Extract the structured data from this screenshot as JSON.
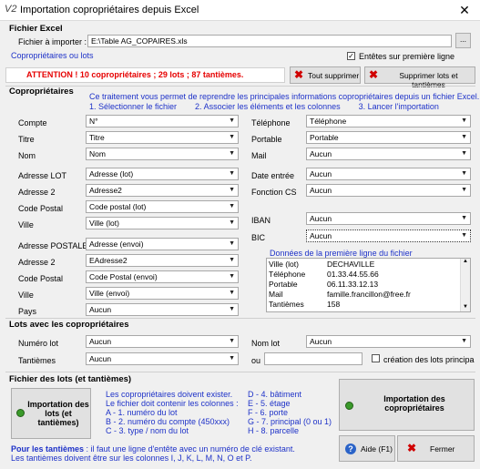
{
  "window": {
    "title": "Importation copropriétaires depuis Excel",
    "app_icon": "V2",
    "close_icon": "close-icon"
  },
  "fichier_excel": {
    "title": "Fichier Excel",
    "file_label": "Fichier à importer :",
    "file_value": "E:\\Table AG_COPAIRES.xls",
    "browse_label": "...",
    "subtitle": "Copropriétaires ou lots",
    "header_checkbox_label": "Entêtes sur première ligne",
    "header_checked": true
  },
  "warning": "ATTENTION ! 10 copropriétaires ; 29 lots ; 87 tantièmes.",
  "buttons": {
    "delete_all": "Tout supprimer",
    "delete_lots": "Supprimer lots et tantièmes",
    "import_lots": "Importation des lots (et tantièmes)",
    "import_owners": "Importation des copropriétaires",
    "help": "Aide (F1)",
    "close": "Fermer"
  },
  "coproprietaires": {
    "title": "Copropriétaires",
    "info": "Ce traitement vous permet de reprendre les principales informations copropriétaires depuis un fichier Excel.",
    "steps": "1. Sélectionner le fichier        2. Associer les éléments et les colonnes        3. Lancer l'importation",
    "left_fields": [
      {
        "label": "Compte",
        "value": "N°"
      },
      {
        "label": "Titre",
        "value": "Titre"
      },
      {
        "label": "Nom",
        "value": "Nom"
      },
      {
        "label": "Adresse LOT",
        "value": "Adresse (lot)"
      },
      {
        "label": "Adresse 2",
        "value": "Adresse2"
      },
      {
        "label": "Code Postal",
        "value": "Code postal (lot)"
      },
      {
        "label": "Ville",
        "value": "Ville (lot)"
      },
      {
        "label": "Adresse POSTALE",
        "value": "Adresse (envoi)"
      },
      {
        "label": "Adresse 2",
        "value": "EAdresse2"
      },
      {
        "label": "Code Postal",
        "value": "Code Postal (envoi)"
      },
      {
        "label": "Ville",
        "value": "Ville (envoi)"
      },
      {
        "label": "Pays",
        "value": "Aucun"
      }
    ],
    "right_fields": [
      {
        "label": "Téléphone",
        "value": "Téléphone"
      },
      {
        "label": "Portable",
        "value": "Portable"
      },
      {
        "label": "Mail",
        "value": "Aucun"
      },
      {
        "label": "Date entrée",
        "value": "Aucun"
      },
      {
        "label": "Fonction CS",
        "value": "Aucun"
      },
      {
        "label": "IBAN",
        "value": "Aucun"
      },
      {
        "label": "BIC",
        "value": "Aucun"
      }
    ],
    "first_line_title": "Données de la première ligne du fichier",
    "first_line_rows": [
      {
        "key": "Ville (lot)",
        "value": "DECHAVILLE"
      },
      {
        "key": "Téléphone",
        "value": "01.33.44.55.66"
      },
      {
        "key": "Portable",
        "value": "06.11.33.12.13"
      },
      {
        "key": "Mail",
        "value": "famille.francillon@free.fr"
      },
      {
        "key": "Tantièmes",
        "value": "158"
      }
    ]
  },
  "lots": {
    "title": "Lots avec les copropriétaires",
    "numero_label": "Numéro lot",
    "numero_value": "Aucun",
    "tantiemes_label": "Tantièmes",
    "tantiemes_value": "Aucun",
    "nom_label": "Nom lot",
    "nom_value": "Aucun",
    "ou_label": "ou",
    "creation_label": "création des lots principa"
  },
  "fichier_lots": {
    "title": "Fichier des lots (et tantièmes)",
    "left_lines": [
      "Les copropriétaires doivent exister.",
      "Le fichier doit contenir les colonnes :",
      "A - 1. numéro du lot",
      "B - 2. numéro du compte (450xxx)",
      "C - 3. type / nom du lot"
    ],
    "right_lines": [
      "D - 4. bâtiment",
      "E - 5. étage",
      "F - 6. porte",
      "G - 7. principal (0 ou 1)",
      "H - 8. parcelle"
    ],
    "tantiemes_bold": "Pour les tantièmes",
    "tantiemes_note": " : il faut une ligne d'entête avec un numéro de clé existant.",
    "tantiemes_note2": "Les tantièmes doivent être sur les colonnes I, J, K, L, M, N, O et P."
  }
}
